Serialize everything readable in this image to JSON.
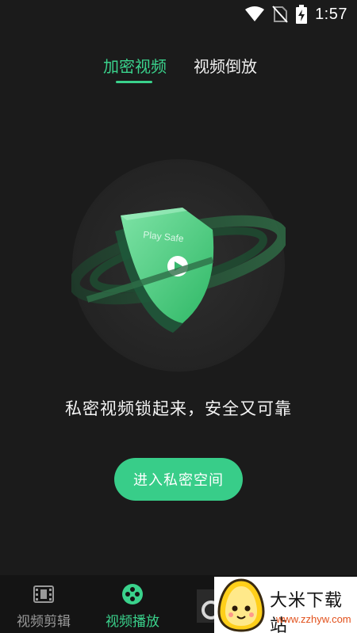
{
  "status_bar": {
    "time": "1:57",
    "icons": [
      "wifi-icon",
      "no-sim-icon",
      "battery-charging-icon"
    ]
  },
  "top_tabs": [
    {
      "label": "加密视频",
      "active": true
    },
    {
      "label": "视频倒放",
      "active": false
    }
  ],
  "hero": {
    "shield_text": "Play Safe"
  },
  "tagline": "私密视频锁起来，安全又可靠",
  "enter_button": {
    "label": "进入私密空间"
  },
  "bottom_nav": [
    {
      "label": "视频剪辑",
      "icon": "film-icon",
      "active": false
    },
    {
      "label": "视频播放",
      "icon": "play-circle-icon",
      "active": true
    }
  ],
  "watermark": {
    "title": "大米下载站",
    "url": "www.zzhyw.com"
  },
  "colors": {
    "accent": "#3ad28c",
    "background": "#1b1b1b",
    "nav_background": "#141414",
    "inactive": "#9a9a9a"
  }
}
